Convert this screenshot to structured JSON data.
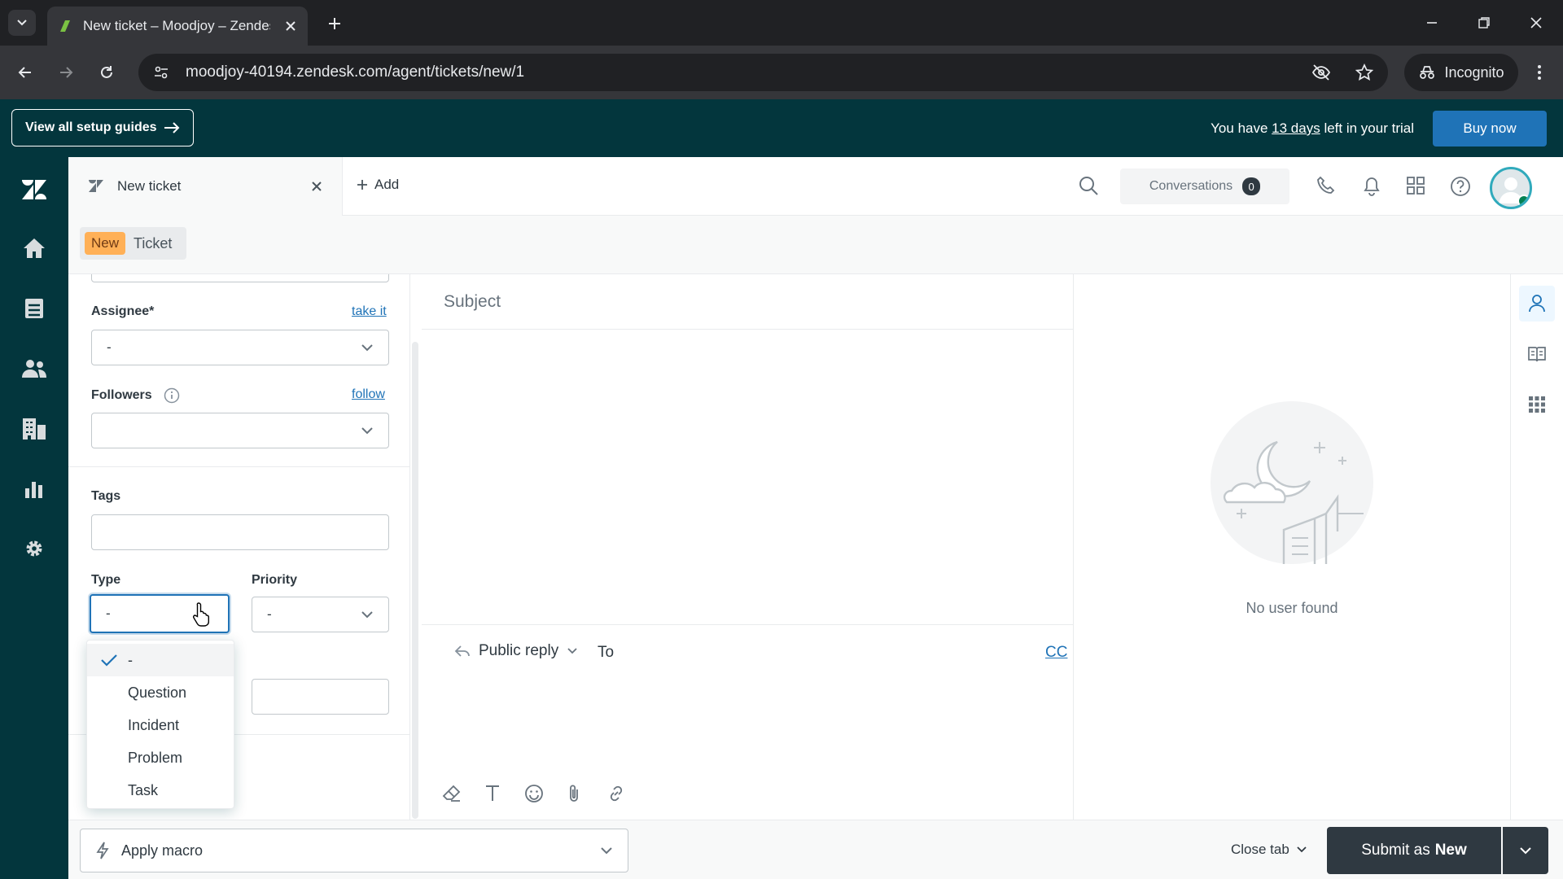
{
  "browser": {
    "tab_title": "New ticket – Moodjoy – Zendesk",
    "url": "moodjoy-40194.zendesk.com/agent/tickets/new/1",
    "incognito_label": "Incognito"
  },
  "banner": {
    "setup_label": "View all setup guides",
    "trial_prefix": "You have",
    "trial_days": "13 days",
    "trial_suffix": "left in your trial",
    "buy_label": "Buy now"
  },
  "header": {
    "tab_label": "New ticket",
    "add_label": "Add",
    "conversations_label": "Conversations",
    "conversations_count": "0"
  },
  "breadcrumb": {
    "status": "New",
    "label": "Ticket"
  },
  "props": {
    "assignee_label": "Assignee*",
    "assignee_action": "take it",
    "assignee_value": "-",
    "followers_label": "Followers",
    "followers_action": "follow",
    "followers_value": "",
    "tags_label": "Tags",
    "type_label": "Type",
    "type_value": "-",
    "priority_label": "Priority",
    "priority_value": "-"
  },
  "type_options": [
    "-",
    "Question",
    "Incident",
    "Problem",
    "Task"
  ],
  "editor": {
    "subject_placeholder": "Subject",
    "reply_mode": "Public reply",
    "to_label": "To",
    "cc_label": "CC"
  },
  "user_panel": {
    "empty_text": "No user found"
  },
  "footer": {
    "macro_label": "Apply macro",
    "close_tab_label": "Close tab",
    "submit_prefix": "Submit as",
    "submit_status": "New"
  },
  "colors": {
    "banner_bg": "#03363d",
    "nav_bg": "#03363d",
    "primary_blue": "#1f73b7",
    "new_badge": "#ffb057",
    "submit_bg": "#2f3941"
  }
}
